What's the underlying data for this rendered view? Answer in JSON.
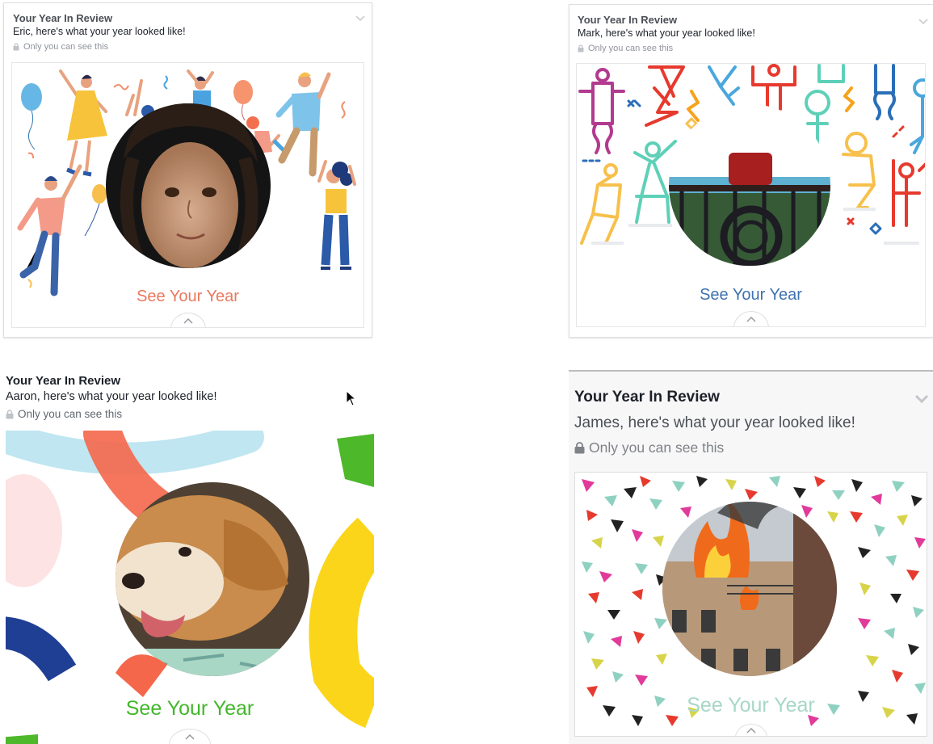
{
  "cards": [
    {
      "title": "Your Year In Review",
      "subtitle": "Eric, here's what your year looked like!",
      "privacy": "Only you can see this",
      "cta": "See Your Year",
      "cta_color": "#e9795d",
      "theme": "dancing-people-illustration",
      "photo": "child-portrait"
    },
    {
      "title": "Your Year In Review",
      "subtitle": "Mark, here's what your year looked like!",
      "privacy": "Only you can see this",
      "cta": "See Your Year",
      "cta_color": "#3f72b0",
      "theme": "stick-figures-line-art",
      "photo": "balcony-railing"
    },
    {
      "title": "Your Year In Review",
      "subtitle": "Aaron, here's what your year looked like!",
      "privacy": "Only you can see this",
      "cta": "See Your Year",
      "cta_color": "#42b72a",
      "theme": "brush-strokes",
      "photo": "golden-dog"
    },
    {
      "title": "Your Year In Review",
      "subtitle": "James, here's what your year looked like!",
      "privacy": "Only you can see this",
      "cta": "See Your Year",
      "cta_color": "#a7d7c6",
      "theme": "triangle-confetti",
      "photo": "burning-building"
    }
  ],
  "colors": {
    "title": "#1d2129",
    "muted": "#90949c",
    "border": "#dddfe2"
  },
  "icons": [
    "lock-icon",
    "chevron-down-icon",
    "chevron-up-icon",
    "mouse-pointer-icon"
  ]
}
